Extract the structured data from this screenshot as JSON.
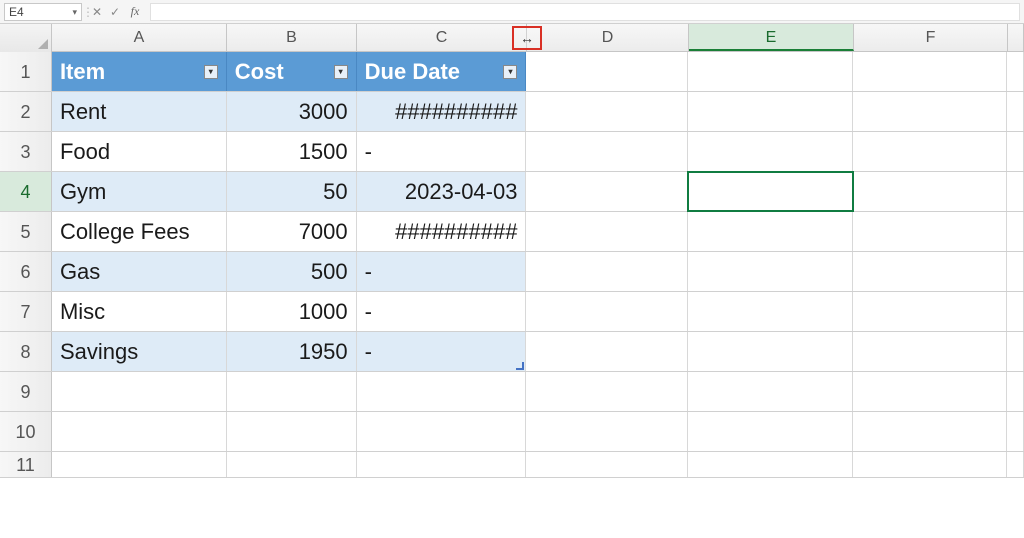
{
  "formula_bar": {
    "cell_ref": "E4",
    "cancel": "✕",
    "confirm": "✓",
    "fx": "fx",
    "value": ""
  },
  "columns": {
    "A": "A",
    "B": "B",
    "C": "C",
    "D": "D",
    "E": "E",
    "F": "F"
  },
  "rows": [
    "1",
    "2",
    "3",
    "4",
    "5",
    "6",
    "7",
    "8",
    "9",
    "10",
    "11"
  ],
  "table": {
    "headers": {
      "item": "Item",
      "cost": "Cost",
      "due": "Due Date"
    },
    "data": [
      {
        "item": "Rent",
        "cost": "3000",
        "due": "##########"
      },
      {
        "item": "Food",
        "cost": "1500",
        "due": "-"
      },
      {
        "item": "Gym",
        "cost": "50",
        "due": "2023-04-03"
      },
      {
        "item": "College Fees",
        "cost": "7000",
        "due": "##########"
      },
      {
        "item": "Gas",
        "cost": "500",
        "due": "-"
      },
      {
        "item": "Misc",
        "cost": "1000",
        "due": "-"
      },
      {
        "item": "Savings",
        "cost": "1950",
        "due": "-"
      }
    ]
  },
  "resize_glyph": "↔"
}
